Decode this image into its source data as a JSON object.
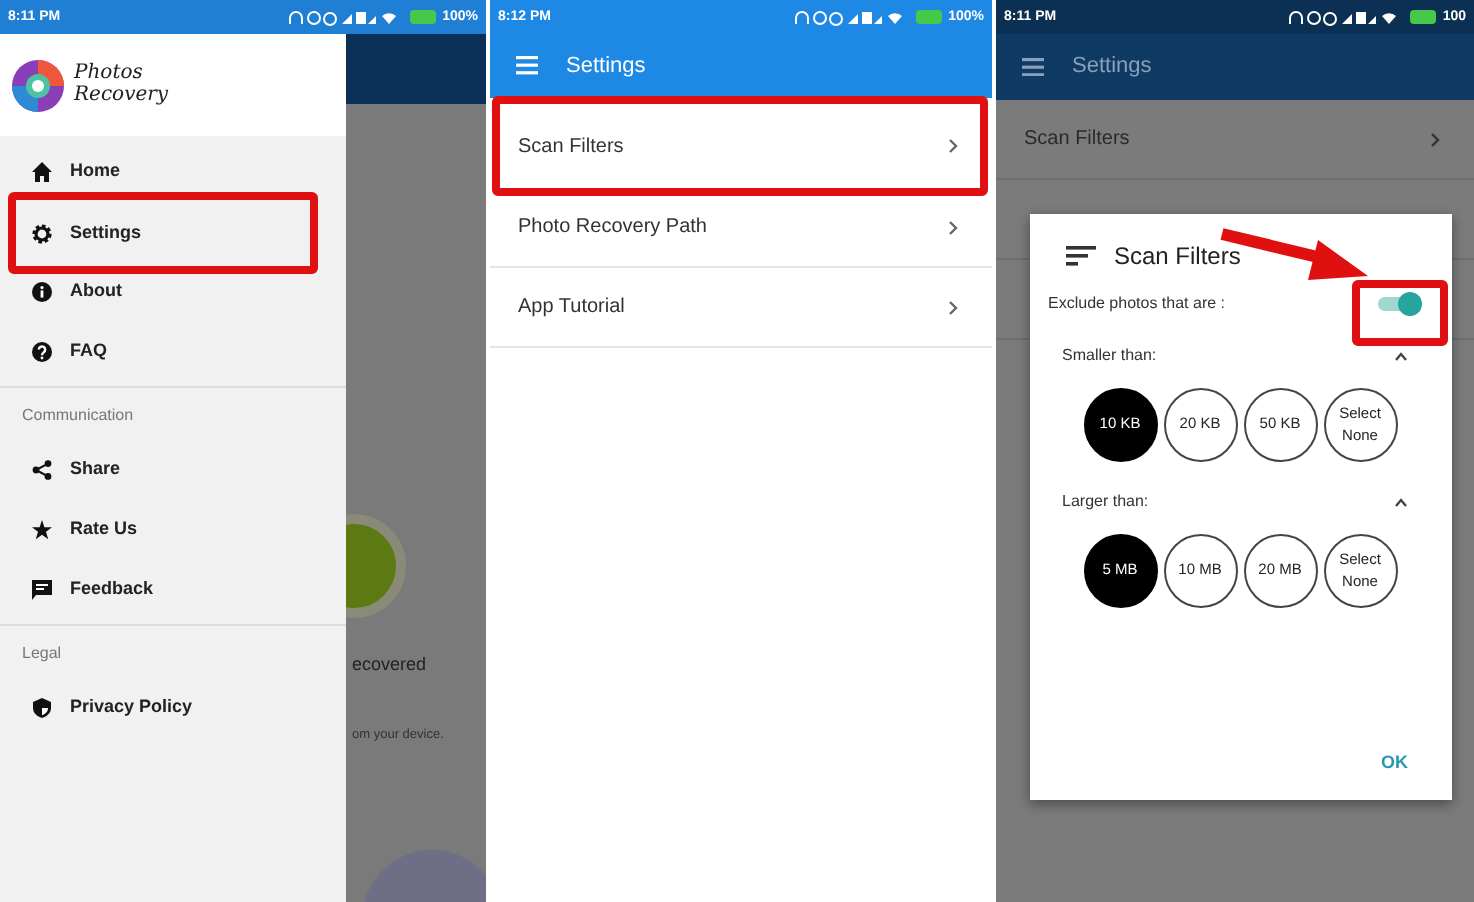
{
  "screens": [
    {
      "kind": "drawer",
      "status_bar": {
        "time": "8:11 PM",
        "battery": "100%"
      },
      "logo_text": [
        "Photos",
        "Recovery"
      ],
      "sections": [
        {
          "items": [
            {
              "label": "Home",
              "highlighted": false
            },
            {
              "label": "Settings",
              "highlighted": true
            },
            {
              "label": "About",
              "highlighted": false
            },
            {
              "label": "FAQ",
              "highlighted": false
            }
          ]
        },
        {
          "header": "Communication",
          "items": [
            {
              "label": "Share",
              "highlighted": false
            },
            {
              "label": "Rate Us",
              "highlighted": false
            },
            {
              "label": "Feedback",
              "highlighted": false
            }
          ]
        },
        {
          "header": "Legal",
          "items": [
            {
              "label": "Privacy Policy",
              "highlighted": false
            }
          ]
        }
      ],
      "background_texts": [
        "ecovered",
        "om your device."
      ]
    },
    {
      "kind": "settings",
      "status_bar": {
        "time": "8:12 PM",
        "battery": "100%"
      },
      "app_bar": {
        "title": "Settings"
      },
      "rows": [
        {
          "label": "Scan Filters",
          "highlighted": true
        },
        {
          "label": "Photo Recovery Path",
          "highlighted": false
        },
        {
          "label": "App Tutorial",
          "highlighted": false
        }
      ]
    },
    {
      "kind": "dialog",
      "status_bar": {
        "time": "8:11 PM",
        "battery": "100"
      },
      "app_bar": {
        "title": "Settings"
      },
      "rows": [
        {
          "label": "Scan Filters"
        }
      ],
      "dialog": {
        "title": "Scan Filters",
        "toggle": {
          "label": "Exclude photos that are :",
          "on": true,
          "highlighted": true
        },
        "groups": [
          {
            "label": "Smaller than:",
            "expanded": true,
            "options": [
              {
                "label": "10 KB",
                "selected": true
              },
              {
                "label": "20 KB",
                "selected": false
              },
              {
                "label": "50 KB",
                "selected": false
              },
              {
                "label": "Select None",
                "selected": false
              }
            ]
          },
          {
            "label": "Larger than:",
            "expanded": true,
            "options": [
              {
                "label": "5 MB",
                "selected": true
              },
              {
                "label": "10 MB",
                "selected": false
              },
              {
                "label": "20 MB",
                "selected": false
              },
              {
                "label": "Select None",
                "selected": false
              }
            ]
          }
        ],
        "ok": "OK"
      }
    }
  ]
}
